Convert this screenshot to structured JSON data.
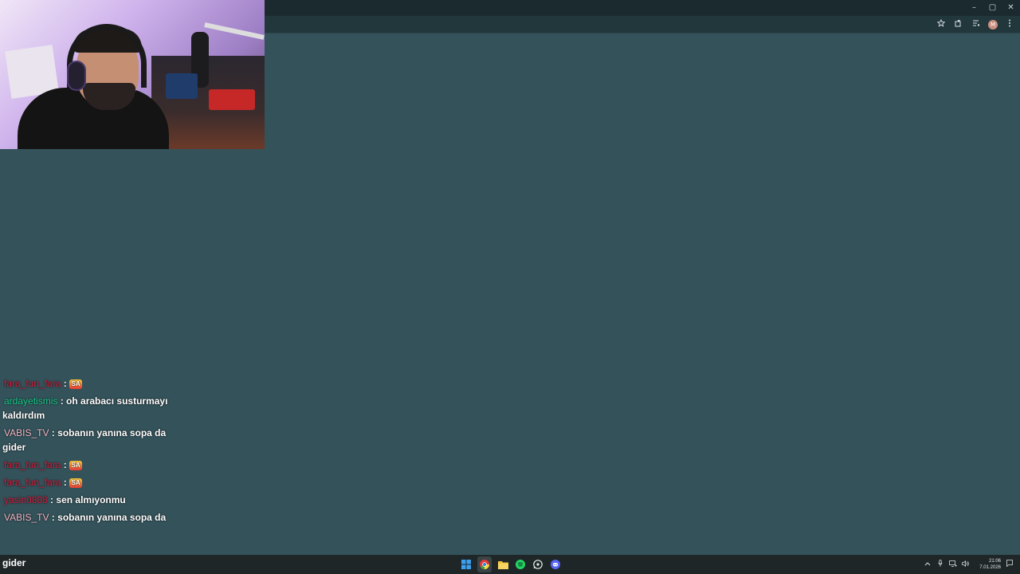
{
  "window": {
    "minimize_icon": "minimize-icon",
    "maximize_icon": "restore-icon",
    "close_icon": "close-icon",
    "minimize_glyph": "–",
    "maximize_glyph": "▢",
    "close_glyph": "✕"
  },
  "toolbar": {
    "icons": [
      "bookmark-star-icon",
      "extensions-icon",
      "media-icon",
      "profile-avatar",
      "menu-icon"
    ],
    "profile_initial": "M"
  },
  "chat": {
    "messages": [
      {
        "user": "fara_fun_fara",
        "text": "",
        "emote": "SA",
        "user_color": "red"
      },
      {
        "user": "ardayetismis",
        "text": "oh arabacı susturmayı kaldırdım",
        "user_color": "green"
      },
      {
        "user": "VABIS_TV",
        "text": "sobanın yanına sopa da gider",
        "user_color": "pink"
      },
      {
        "user": "fara_fun_fara",
        "text": "",
        "emote": "SA",
        "user_color": "red"
      },
      {
        "user": "fara_fun_fara",
        "text": "",
        "emote": "SA",
        "user_color": "red"
      },
      {
        "user": "yasin0808",
        "text": "sen almıyonmu",
        "user_color": "red"
      },
      {
        "user": "VABIS_TV",
        "text": "sobanın yanına sopa da",
        "user_color": "pink"
      }
    ],
    "overflow_text": "gider"
  },
  "taskbar": {
    "apps": [
      "windows-start-icon",
      "chrome-icon",
      "file-explorer-icon",
      "spotify-icon",
      "whatsapp-icon",
      "discord-icon"
    ],
    "tray_icons": [
      "chevron-up-icon",
      "microphone-icon",
      "network-icon",
      "volume-icon",
      "notification-icon"
    ],
    "time": "21:06",
    "date": "7.01.2026"
  },
  "colors": {
    "page_bg": "#33525a",
    "titlebar": "#1b2a2e",
    "toolbar": "#22373c",
    "taskbar": "#1f2628"
  }
}
